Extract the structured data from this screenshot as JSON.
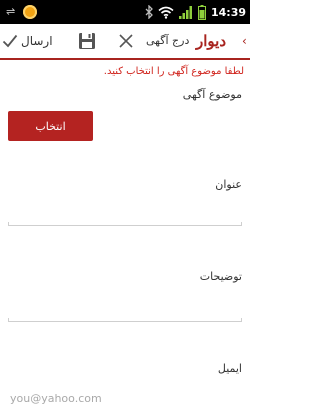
{
  "status_bar": {
    "time": "14:39",
    "icons": [
      "usb-icon",
      "notification-icon",
      "bluetooth-icon",
      "wifi-icon",
      "signal-icon",
      "battery-icon"
    ]
  },
  "action_bar": {
    "send_label": "ارسال",
    "title": "درج آگهی",
    "brand": "دیوار",
    "back_icon": "chevron-left-icon",
    "accent_color": "#a8241f"
  },
  "form": {
    "error_message": "لطفا موضوع آگهی را انتخاب کنید.",
    "category_label": "موضوع آگهی",
    "select_button_label": "انتخاب",
    "title_label": "عنوان",
    "title_value": "",
    "description_label": "توضیحات",
    "description_value": "",
    "email_label": "ایمیل",
    "email_placeholder": "you@yahoo.com",
    "button_color": "#b42321",
    "error_color": "#d0231c"
  }
}
